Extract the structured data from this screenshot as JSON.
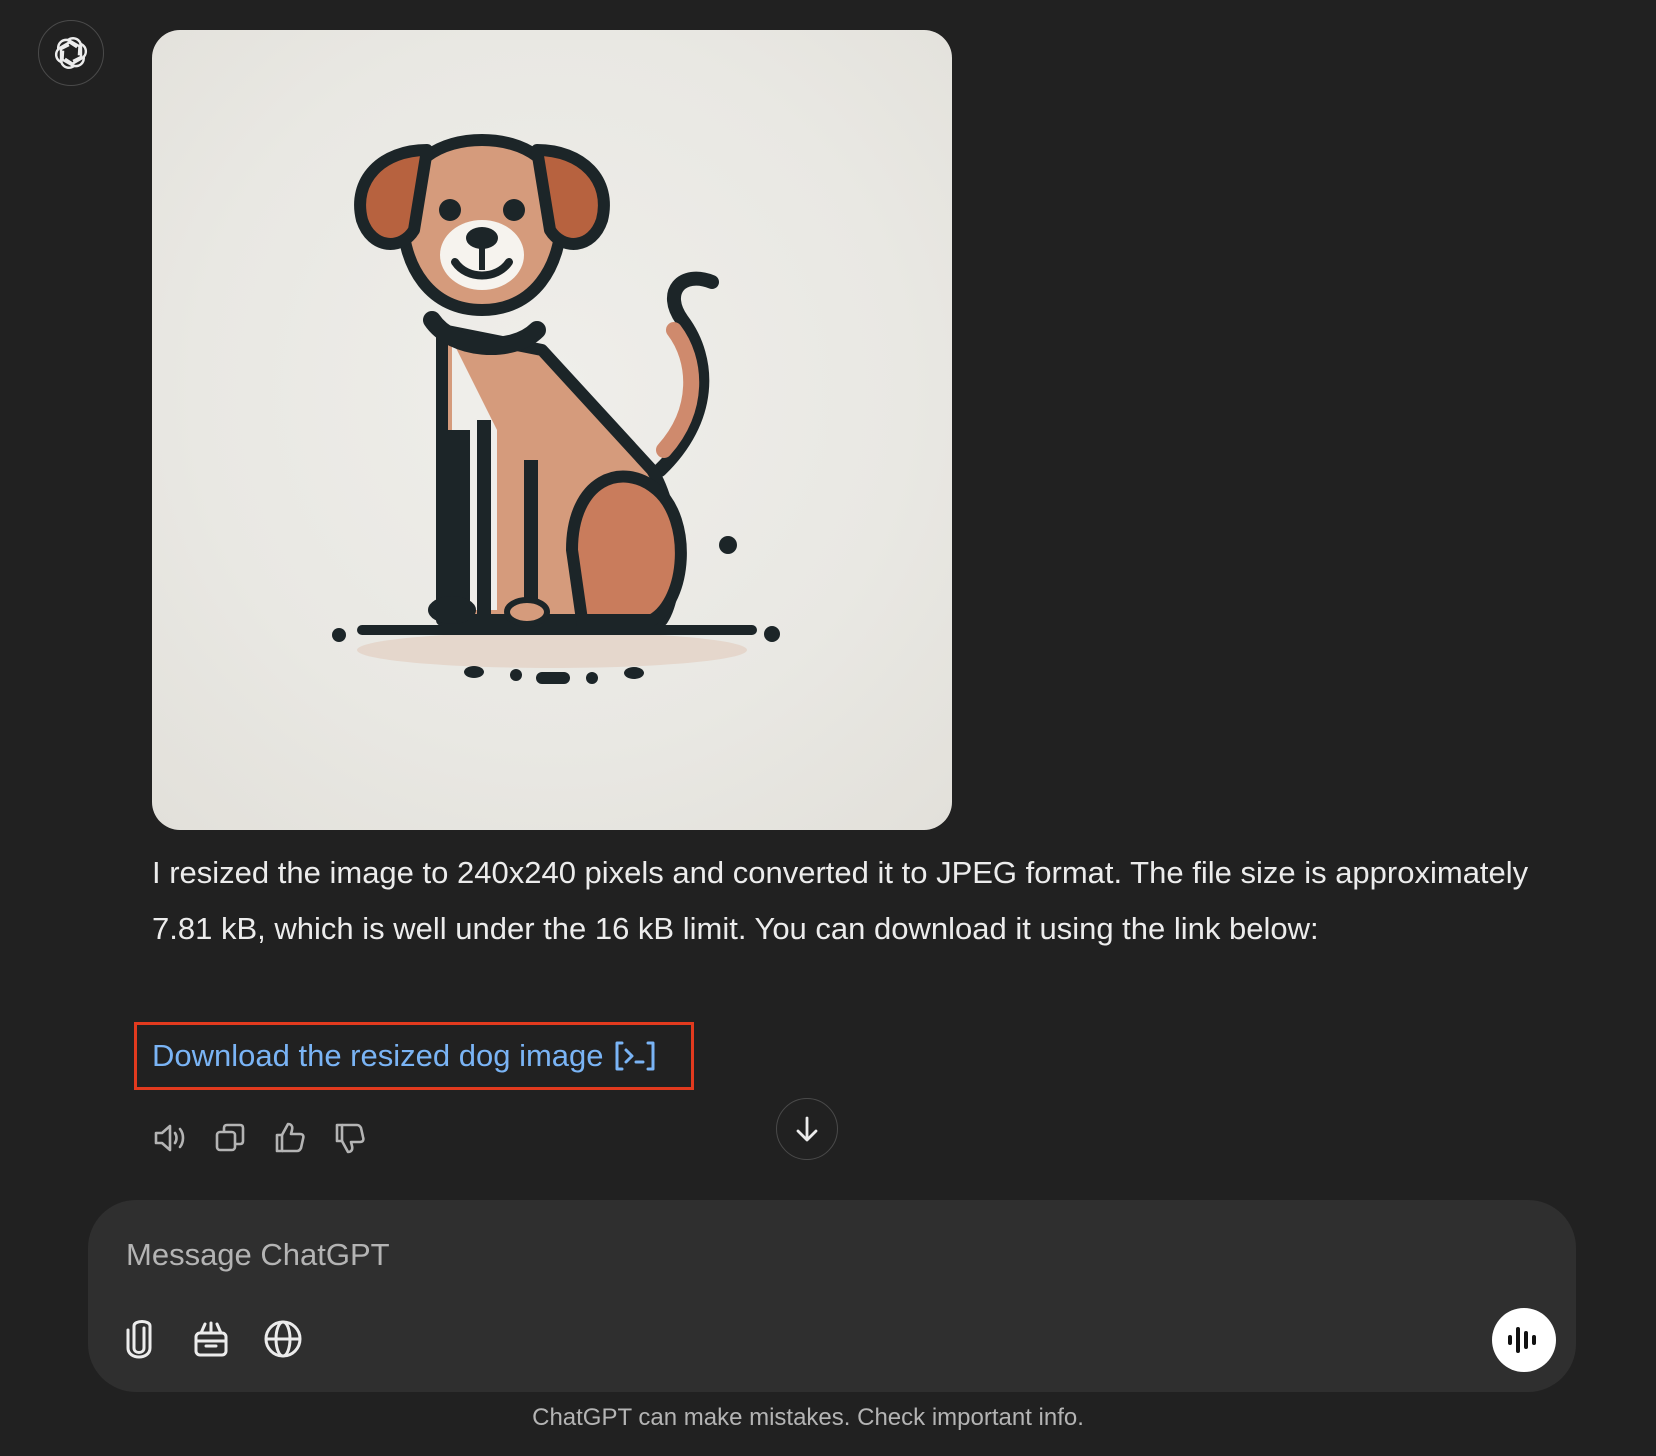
{
  "assistant": {
    "avatar_icon": "openai-logo-icon"
  },
  "message": {
    "image_alt": "Illustration of a sitting dog",
    "text": "I resized the image to 240x240 pixels and converted it to JPEG format. The file size is approximately 7.81 kB, which is well under the 16 kB limit. You can download it using the link below:",
    "link_label": "Download the resized dog image",
    "link_icon": "code-interpreter-icon",
    "highlight_color": "#e23a1e",
    "link_color": "#7ab4f5"
  },
  "actions": [
    {
      "name": "read-aloud-button",
      "icon": "speaker-icon"
    },
    {
      "name": "copy-button",
      "icon": "copy-icon"
    },
    {
      "name": "thumbs-up-button",
      "icon": "thumbs-up-icon"
    },
    {
      "name": "thumbs-down-button",
      "icon": "thumbs-down-icon"
    }
  ],
  "scroll_down_icon": "arrow-down-icon",
  "composer": {
    "placeholder": "Message ChatGPT",
    "tools": [
      {
        "name": "attach-button",
        "icon": "paperclip-icon"
      },
      {
        "name": "tools-button",
        "icon": "toolbox-icon"
      },
      {
        "name": "web-search-button",
        "icon": "globe-icon"
      }
    ],
    "voice_icon": "voice-mode-icon"
  },
  "footer": {
    "disclaimer": "ChatGPT can make mistakes. Check important info."
  },
  "colors": {
    "background": "#212121",
    "composer_bg": "#2f2f2f",
    "text": "#ececec",
    "muted_text": "#b4b4b4"
  }
}
